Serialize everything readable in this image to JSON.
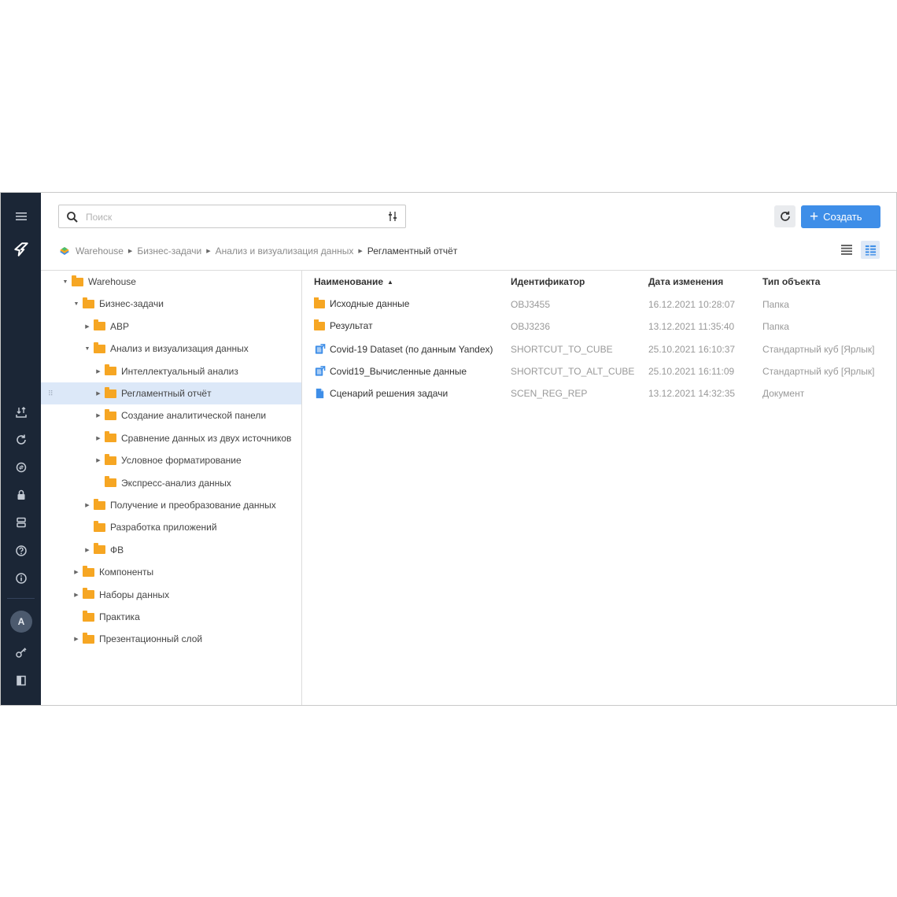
{
  "search": {
    "placeholder": "Поиск"
  },
  "toolbar": {
    "create_label": "Создать"
  },
  "breadcrumb": [
    "Warehouse",
    "Бизнес-задачи",
    "Анализ и визуализация данных",
    "Регламентный отчёт"
  ],
  "tree": [
    {
      "label": "Warehouse",
      "level": 0,
      "toggle": "open"
    },
    {
      "label": "Бизнес-задачи",
      "level": 1,
      "toggle": "open"
    },
    {
      "label": "АВР",
      "level": 2,
      "toggle": "closed"
    },
    {
      "label": "Анализ и визуализация данных",
      "level": 2,
      "toggle": "open"
    },
    {
      "label": "Интеллектуальный анализ",
      "level": 3,
      "toggle": "closed"
    },
    {
      "label": "Регламентный отчёт",
      "level": 3,
      "toggle": "closed",
      "selected": true
    },
    {
      "label": "Создание аналитической панели",
      "level": 3,
      "toggle": "closed"
    },
    {
      "label": "Сравнение данных из двух источников",
      "level": 3,
      "toggle": "closed"
    },
    {
      "label": "Условное форматирование",
      "level": 3,
      "toggle": "closed"
    },
    {
      "label": "Экспресс-анализ данных",
      "level": 3,
      "toggle": "none"
    },
    {
      "label": "Получение и преобразование данных",
      "level": 2,
      "toggle": "closed"
    },
    {
      "label": "Разработка приложений",
      "level": 2,
      "toggle": "none"
    },
    {
      "label": "ФВ",
      "level": 2,
      "toggle": "closed"
    },
    {
      "label": "Компоненты",
      "level": 1,
      "toggle": "closed"
    },
    {
      "label": "Наборы данных",
      "level": 1,
      "toggle": "closed"
    },
    {
      "label": "Практика",
      "level": 1,
      "toggle": "none"
    },
    {
      "label": "Презентационный слой",
      "level": 1,
      "toggle": "closed"
    }
  ],
  "table": {
    "columns": [
      "Наименование",
      "Идентификатор",
      "Дата изменения",
      "Тип объекта"
    ],
    "rows": [
      {
        "icon": "folder-icon",
        "name": "Исходные данные",
        "id": "OBJ3455",
        "date": "16.12.2021 10:28:07",
        "type": "Папка"
      },
      {
        "icon": "folder-icon",
        "name": "Результат",
        "id": "OBJ3236",
        "date": "13.12.2021 11:35:40",
        "type": "Папка"
      },
      {
        "icon": "cube-shortcut-icon",
        "name": "Covid-19 Dataset (по данным Yandex)",
        "id": "SHORTCUT_TO_CUBE",
        "date": "25.10.2021 16:10:37",
        "type": "Стандартный куб [Ярлык]"
      },
      {
        "icon": "cube-shortcut-icon",
        "name": "Covid19_Вычисленные данные",
        "id": "SHORTCUT_TO_ALT_CUBE",
        "date": "25.10.2021 16:11:09",
        "type": "Стандартный куб [Ярлык]"
      },
      {
        "icon": "document-icon",
        "name": "Сценарий решения задачи",
        "id": "SCEN_REG_REP",
        "date": "13.12.2021 14:32:35",
        "type": "Документ"
      }
    ]
  },
  "user": {
    "avatar_initial": "A"
  },
  "colors": {
    "rail": "#1b2636",
    "accent": "#3e8ee8",
    "folder": "#f6a623",
    "selected_row": "#dce8f8"
  }
}
